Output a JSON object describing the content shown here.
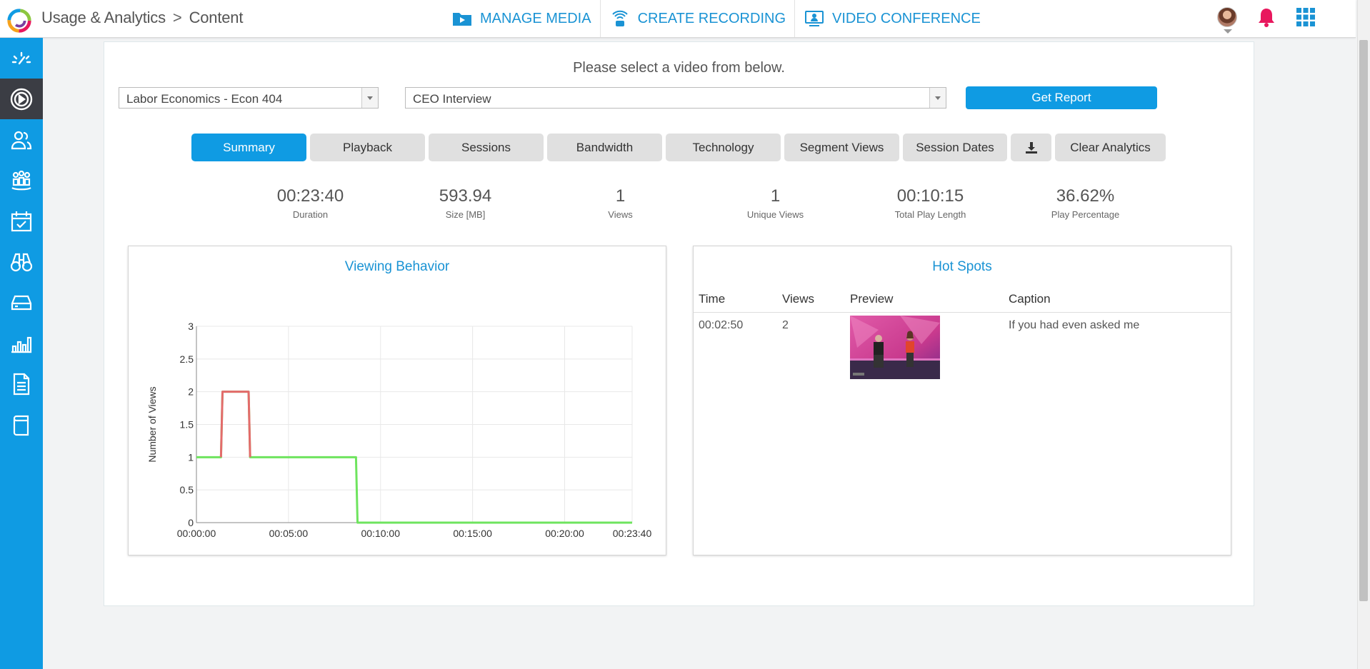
{
  "header": {
    "breadcrumb_section": "Usage & Analytics",
    "breadcrumb_sep": ">",
    "breadcrumb_page": "Content",
    "nav": [
      {
        "label": "MANAGE MEDIA",
        "icon": "media-folder-icon"
      },
      {
        "label": "CREATE RECORDING",
        "icon": "recording-icon"
      },
      {
        "label": "VIDEO CONFERENCE",
        "icon": "conference-icon"
      }
    ]
  },
  "colors": {
    "accent": "#0f9be3",
    "sidebar_active": "#3b3d44",
    "series_red": "#e46b6b",
    "series_green": "#6ee45e",
    "bell": "#e8175d"
  },
  "sidebar": {
    "items": [
      {
        "icon": "dashboard-icon",
        "active": false
      },
      {
        "icon": "analytics-play-icon",
        "active": true
      },
      {
        "icon": "users-icon",
        "active": false
      },
      {
        "icon": "groups-icon",
        "active": false
      },
      {
        "icon": "calendar-check-icon",
        "active": false
      },
      {
        "icon": "binoculars-icon",
        "active": false
      },
      {
        "icon": "storage-drive-icon",
        "active": false
      },
      {
        "icon": "bar-chart-icon",
        "active": false
      },
      {
        "icon": "document-icon",
        "active": false
      },
      {
        "icon": "book-icon",
        "active": false
      }
    ]
  },
  "main": {
    "prompt": "Please select a video from below.",
    "course_select": "Labor Economics - Econ 404",
    "video_select": "CEO Interview",
    "get_report": "Get Report",
    "tabs": [
      "Summary",
      "Playback",
      "Sessions",
      "Bandwidth",
      "Technology",
      "Segment Views",
      "Session Dates",
      "",
      "Clear Analytics"
    ],
    "active_tab": "Summary",
    "download_icon": "download-icon",
    "stats": [
      {
        "value": "00:23:40",
        "label": "Duration"
      },
      {
        "value": "593.94",
        "label": "Size [MB]"
      },
      {
        "value": "1",
        "label": "Views"
      },
      {
        "value": "1",
        "label": "Unique Views"
      },
      {
        "value": "00:10:15",
        "label": "Total Play Length"
      },
      {
        "value": "36.62%",
        "label": "Play Percentage"
      }
    ]
  },
  "viewing_behavior": {
    "title": "Viewing Behavior"
  },
  "hot_spots": {
    "title": "Hot Spots",
    "columns": [
      "Time",
      "Views",
      "Preview",
      "Caption"
    ],
    "rows": [
      {
        "time": "00:02:50",
        "views": "2",
        "caption": "If you had even asked me"
      }
    ]
  },
  "chart_data": {
    "type": "line",
    "title": "",
    "xlabel": "",
    "ylabel": "Number of Views",
    "xlim": [
      0,
      1420
    ],
    "ylim": [
      0,
      3
    ],
    "x_ticks": [
      {
        "v": 0,
        "label": "00:00:00"
      },
      {
        "v": 300,
        "label": "00:05:00"
      },
      {
        "v": 600,
        "label": "00:10:00"
      },
      {
        "v": 900,
        "label": "00:15:00"
      },
      {
        "v": 1200,
        "label": "00:20:00"
      },
      {
        "v": 1420,
        "label": "00:23:40"
      }
    ],
    "y_ticks": [
      "0",
      "0.5",
      "1",
      "1.5",
      "2",
      "2.5",
      "3"
    ],
    "grid": true,
    "series": [
      {
        "color": "#6ee45e",
        "x": [
          0,
          80,
          85,
          170,
          175,
          520,
          525,
          1420
        ],
        "y": [
          1,
          1,
          2,
          2,
          1,
          1,
          0,
          0
        ]
      },
      {
        "color": "#e46b6b",
        "x": [
          80,
          85,
          170,
          175
        ],
        "y": [
          1,
          2,
          2,
          1
        ]
      }
    ]
  }
}
